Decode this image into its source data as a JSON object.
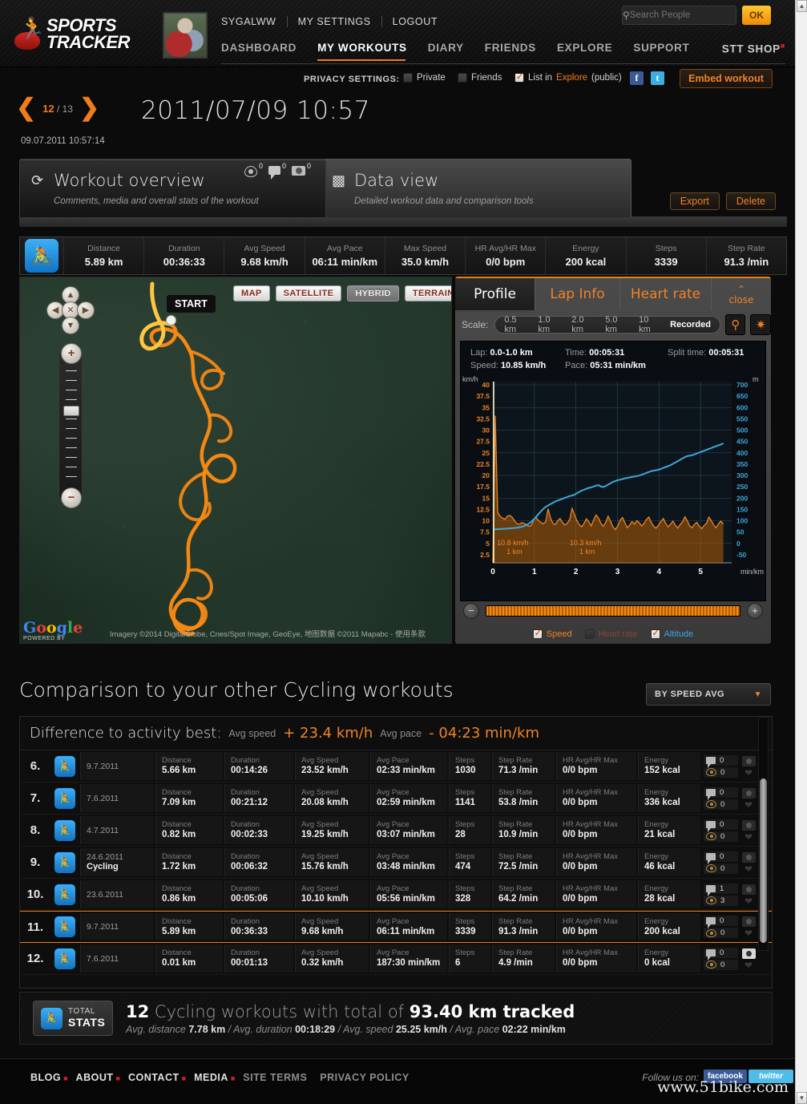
{
  "header": {
    "brand_line1": "SPORTS",
    "brand_line2": "TRACKER",
    "user_links": [
      "SYGALWW",
      "MY SETTINGS",
      "LOGOUT"
    ],
    "nav": [
      {
        "label": "DASHBOARD",
        "active": false
      },
      {
        "label": "MY WORKOUTS",
        "active": true
      },
      {
        "label": "DIARY",
        "active": false
      },
      {
        "label": "FRIENDS",
        "active": false
      },
      {
        "label": "EXPLORE",
        "active": false
      },
      {
        "label": "SUPPORT",
        "active": false
      }
    ],
    "shop_label": "STT SHOP",
    "search_placeholder": "Search People",
    "search_value": "",
    "ok_label": "OK",
    "accent": "#ef7d1a"
  },
  "privacy": {
    "label": "PRIVACY SETTINGS:",
    "private_label": "Private",
    "friends_label": "Friends",
    "explore_prefix": "List in ",
    "explore_hl": "Explore",
    "explore_suffix": " (public)",
    "facebook_glyph": "f",
    "twitter_glyph": "t",
    "embed_label": "Embed workout"
  },
  "workout": {
    "pager_current": "12",
    "pager_total": "/ 13",
    "prev_glyph": "❮",
    "next_glyph": "❯",
    "title": "2011/07/09 10:57",
    "date_full": "09.07.2011 10:57:14"
  },
  "view_tabs": {
    "overview": {
      "title": "Workout overview",
      "subtitle": "Comments, media and overall stats of the workout",
      "icon": "◌",
      "counts": {
        "views": "0",
        "comments": "0",
        "photos": "0"
      }
    },
    "dataview": {
      "title": "Data view",
      "subtitle": "Detailed workout data and comparison tools",
      "icon": "bars"
    },
    "export_label": "Export",
    "delete_label": "Delete"
  },
  "summary": {
    "sport_icon": "🚴",
    "cells": [
      {
        "key": "Distance",
        "value": "5.89 km"
      },
      {
        "key": "Duration",
        "value": "00:36:33"
      },
      {
        "key": "Avg Speed",
        "value": "9.68 km/h"
      },
      {
        "key": "Avg Pace",
        "value": "06:11 min/km"
      },
      {
        "key": "Max Speed",
        "value": "35.0 km/h"
      },
      {
        "key": "HR Avg/HR Max",
        "value": "0/0 bpm"
      },
      {
        "key": "Energy",
        "value": "200 kcal"
      },
      {
        "key": "Steps",
        "value": "3339"
      },
      {
        "key": "Step Rate",
        "value": "91.3 /min"
      }
    ]
  },
  "map": {
    "types": [
      {
        "label": "MAP",
        "selected": false
      },
      {
        "label": "SATELLITE",
        "selected": false
      },
      {
        "label": "HYBRID",
        "selected": true
      },
      {
        "label": "TERRAIN",
        "selected": false
      }
    ],
    "start_label": "START",
    "powered_by": "POWERED BY",
    "google_letters": [
      "G",
      "o",
      "o",
      "g",
      "l",
      "e"
    ],
    "attribution": "Imagery ©2014 DigitalGlobe, Cnes/Spot Image, GeoEye, 地图数据 ©2011 Mapabc - 使用条款",
    "pan_up": "▲",
    "pan_down": "▼",
    "pan_left": "◀",
    "pan_right": "▶",
    "pan_center": "✕",
    "zoom_in": "+",
    "zoom_out": "−"
  },
  "chart_panel": {
    "tabs": [
      {
        "label": "Profile",
        "active": true
      },
      {
        "label": "Lap Info",
        "active": false
      },
      {
        "label": "Heart rate",
        "active": false
      }
    ],
    "close_label": "close",
    "close_arrow": "⌃",
    "scale_label": "Scale:",
    "scale_options": [
      {
        "label": "0.5 km",
        "selected": false
      },
      {
        "label": "1.0 km",
        "selected": false
      },
      {
        "label": "2.0 km",
        "selected": false
      },
      {
        "label": "5.0 km",
        "selected": false
      },
      {
        "label": "10 km",
        "selected": false
      },
      {
        "label": "Recorded",
        "selected": true
      }
    ],
    "zoom_icon": "🔍",
    "fullscreen_icon": "✥",
    "lap_readout": {
      "lap_key": "Lap:",
      "lap_val": "0.0-1.0 km",
      "time_key": "Time:",
      "time_val": "00:05:31",
      "split_key": "Split time:",
      "split_val": "00:05:31",
      "speed_key": "Speed:",
      "speed_val": "10.85 km/h",
      "pace_key": "Pace:",
      "pace_val": "05:31 min/km"
    },
    "legend": [
      {
        "label": "Speed",
        "checked": true,
        "color": "#ef8326"
      },
      {
        "label": "Heart rate",
        "checked": false,
        "color": "#a14b3a"
      },
      {
        "label": "Altitude",
        "checked": true,
        "color": "#3ea6d8"
      }
    ],
    "slider_minus": "−",
    "slider_plus": "+"
  },
  "chart_data": {
    "type": "line",
    "title": "Profile",
    "xlabel": "min/km",
    "x_ticks": [
      "0",
      "1",
      "2",
      "3",
      "4",
      "5"
    ],
    "xlim": [
      0,
      5.75
    ],
    "left_axis": {
      "label": "km/h",
      "ticks": [
        "40",
        "37.5",
        "35",
        "32.5",
        "30",
        "27.5",
        "25",
        "22.5",
        "20",
        "17.5",
        "15",
        "12.5",
        "10",
        "7.5",
        "5",
        "2.5"
      ],
      "range": [
        0,
        41.25
      ],
      "color": "#ef8326"
    },
    "right_axis": {
      "label": "m",
      "ticks": [
        "700",
        "650",
        "600",
        "550",
        "500",
        "450",
        "400",
        "350",
        "300",
        "250",
        "200",
        "150",
        "100",
        "50",
        "0",
        "-50"
      ],
      "range": [
        -75,
        725
      ],
      "color": "#3ea6d8"
    },
    "annotations": [
      {
        "text": "10.8 km/h",
        "sub": "1 km",
        "x": 0.1
      },
      {
        "text": "10.3 km/h",
        "sub": "1 km",
        "x": 1.85
      }
    ],
    "series": [
      {
        "name": "Speed",
        "color": "#ef8326",
        "unit": "km/h",
        "axis": "left",
        "values": [
          0,
          33.5,
          11.5,
          10.6,
          10.2,
          9.9,
          10.6,
          10.8,
          10.4,
          9.6,
          8.9,
          8.8,
          9.1,
          9.0,
          8.7,
          8.3,
          8.5,
          9.8,
          10.4,
          9.6,
          9.2,
          8.9,
          9.3,
          12.3,
          10.2,
          9.0,
          8.7,
          9.6,
          10.1,
          9.2,
          8.6,
          9.0,
          9.9,
          12.4,
          11.0,
          9.6,
          8.7,
          8.2,
          9.0,
          10.0,
          9.3,
          8.4,
          9.8,
          10.9,
          10.2,
          9.0,
          8.3,
          9.2,
          10.6,
          9.5,
          8.2,
          7.6,
          8.4,
          9.7,
          10.3,
          9.1,
          8.0,
          8.6,
          9.4,
          8.8,
          9.6,
          9.1,
          8.4,
          9.0,
          9.9,
          10.4,
          9.2,
          8.3,
          7.9,
          8.6,
          9.4,
          10.1,
          9.0,
          8.2,
          8.8,
          9.5,
          8.6,
          7.9,
          8.7,
          9.3,
          10.5,
          9.6,
          8.4,
          8.0,
          8.8,
          9.2,
          8.3,
          7.8,
          8.5,
          9.0,
          10.4,
          9.6,
          8.6,
          8.0,
          8.9,
          9.5,
          8.8
        ]
      },
      {
        "name": "Altitude",
        "color": "#3ea6d8",
        "unit": "m",
        "axis": "right",
        "values": [
          72,
          73,
          74,
          74,
          75,
          75,
          76,
          77,
          78,
          79,
          80,
          82,
          84,
          87,
          92,
          98,
          106,
          116,
          128,
          140,
          152,
          163,
          172,
          178,
          184,
          190,
          196,
          200,
          204,
          208,
          212,
          216,
          220,
          222,
          226,
          232,
          238,
          244,
          248,
          252,
          256,
          258,
          262,
          266,
          268,
          262,
          260,
          264,
          270,
          276,
          282,
          286,
          290,
          292,
          295,
          298,
          300,
          302,
          304,
          306,
          308,
          310,
          314,
          318,
          322,
          326,
          330,
          332,
          334,
          336,
          340,
          344,
          348,
          352,
          356,
          362,
          368,
          374,
          380,
          386,
          392,
          396,
          398,
          400,
          404,
          408,
          412,
          416,
          420,
          424,
          428,
          432,
          436,
          440,
          444,
          448,
          452
        ]
      }
    ]
  },
  "comparison": {
    "title": "Comparison to your other Cycling workouts",
    "sort_label": "BY SPEED AVG",
    "diff_title": "Difference to activity best:",
    "diff_items": [
      {
        "key": "Avg speed",
        "value": "+ 23.4 km/h"
      },
      {
        "key": "Avg pace",
        "value": "- 04:23 min/km"
      }
    ],
    "labels": {
      "distance": "Distance",
      "duration": "Duration",
      "avg_speed": "Avg Speed",
      "avg_pace": "Avg Pace",
      "steps": "Steps",
      "step_rate": "Step Rate",
      "hr": "HR Avg/HR Max",
      "energy": "Energy"
    },
    "rows": [
      {
        "num": "6.",
        "date": "9.7.2011",
        "name": "",
        "distance": "5.66 km",
        "duration": "00:14:26",
        "avg_speed": "23.52 km/h",
        "avg_pace": "02:33 min/km",
        "steps": "1030",
        "step_rate": "71.3 /min",
        "hr": "0/0 bpm",
        "energy": "152 kcal",
        "comments": "0",
        "views": "0",
        "photo": false,
        "highlight": false
      },
      {
        "num": "7.",
        "date": "7.6.2011",
        "name": "",
        "distance": "7.09 km",
        "duration": "00:21:12",
        "avg_speed": "20.08 km/h",
        "avg_pace": "02:59 min/km",
        "steps": "1141",
        "step_rate": "53.8 /min",
        "hr": "0/0 bpm",
        "energy": "336 kcal",
        "comments": "0",
        "views": "0",
        "photo": false,
        "highlight": false
      },
      {
        "num": "8.",
        "date": "4.7.2011",
        "name": "",
        "distance": "0.82 km",
        "duration": "00:02:33",
        "avg_speed": "19.25 km/h",
        "avg_pace": "03:07 min/km",
        "steps": "28",
        "step_rate": "10.9 /min",
        "hr": "0/0 bpm",
        "energy": "21 kcal",
        "comments": "0",
        "views": "0",
        "photo": false,
        "highlight": false
      },
      {
        "num": "9.",
        "date": "24.6.2011",
        "name": "Cycling",
        "distance": "1.72 km",
        "duration": "00:06:32",
        "avg_speed": "15.76 km/h",
        "avg_pace": "03:48 min/km",
        "steps": "474",
        "step_rate": "72.5 /min",
        "hr": "0/0 bpm",
        "energy": "46 kcal",
        "comments": "0",
        "views": "0",
        "photo": false,
        "highlight": false
      },
      {
        "num": "10.",
        "date": "23.6.2011",
        "name": "",
        "distance": "0.86 km",
        "duration": "00:05:06",
        "avg_speed": "10.10 km/h",
        "avg_pace": "05:56 min/km",
        "steps": "328",
        "step_rate": "64.2 /min",
        "hr": "0/0 bpm",
        "energy": "28 kcal",
        "comments": "1",
        "views": "3",
        "photo": false,
        "highlight": false
      },
      {
        "num": "11.",
        "date": "9.7.2011",
        "name": "",
        "distance": "5.89 km",
        "duration": "00:36:33",
        "avg_speed": "9.68 km/h",
        "avg_pace": "06:11 min/km",
        "steps": "3339",
        "step_rate": "91.3 /min",
        "hr": "0/0 bpm",
        "energy": "200 kcal",
        "comments": "0",
        "views": "0",
        "photo": false,
        "highlight": true
      },
      {
        "num": "12.",
        "date": "7.6.2011",
        "name": "",
        "distance": "0.01 km",
        "duration": "00:01:13",
        "avg_speed": "0.32 km/h",
        "avg_pace": "187:30 min/km",
        "steps": "6",
        "step_rate": "4.9 /min",
        "hr": "0/0 bpm",
        "energy": "0 kcal",
        "comments": "0",
        "views": "0",
        "photo": true,
        "highlight": false
      }
    ]
  },
  "total_stats": {
    "badge_line1": "TOTAL",
    "badge_line2": "STATS",
    "count": "12",
    "line_mid": "Cycling workouts with total of",
    "total_km": "93.40 km tracked",
    "avg_distance_key": "Avg. distance",
    "avg_distance_val": "7.78 km",
    "avg_duration_key": "Avg. duration",
    "avg_duration_val": "00:18:29",
    "avg_speed_key": "Avg. speed",
    "avg_speed_val": "25.25 km/h",
    "avg_pace_key": "Avg. pace",
    "avg_pace_val": "02:22 min/km",
    "sep": "/"
  },
  "footer": {
    "links": [
      {
        "label": "BLOG",
        "dim": false,
        "dot": true
      },
      {
        "label": "ABOUT",
        "dim": false,
        "dot": true
      },
      {
        "label": "CONTACT",
        "dim": false,
        "dot": true
      },
      {
        "label": "MEDIA",
        "dim": false,
        "dot": true
      },
      {
        "label": "SITE TERMS",
        "dim": true,
        "dot": false
      },
      {
        "label": "PRIVACY POLICY",
        "dim": true,
        "dot": false
      }
    ],
    "follow_label": "Follow us on:",
    "facebook_label": "facebook",
    "twitter_label": "twitter",
    "watermark": "www.51bike.com"
  }
}
